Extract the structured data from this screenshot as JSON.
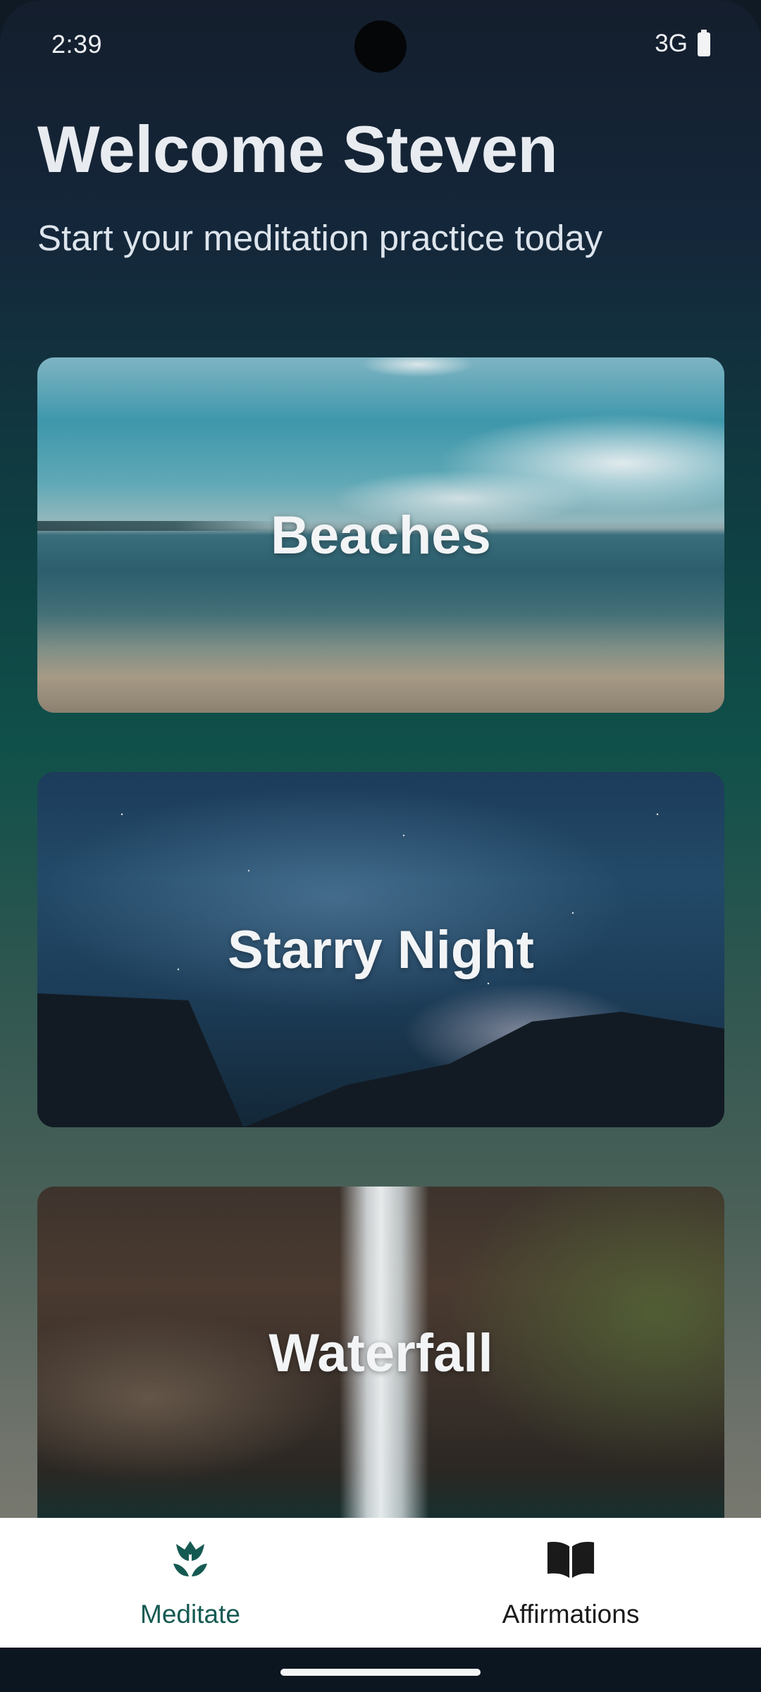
{
  "status_bar": {
    "time": "2:39",
    "network": "3G",
    "battery_icon": "battery-full-icon"
  },
  "header": {
    "title": "Welcome Steven",
    "subtitle": "Start your meditation practice today"
  },
  "cards": [
    {
      "label": "Beaches"
    },
    {
      "label": "Starry Night"
    },
    {
      "label": "Waterfall"
    }
  ],
  "bottom_nav": {
    "items": [
      {
        "label": "Meditate",
        "icon": "lotus-icon",
        "active": true,
        "color": "#155a52"
      },
      {
        "label": "Affirmations",
        "icon": "open-book-icon",
        "active": false,
        "color": "#1a1a1a"
      }
    ]
  },
  "colors": {
    "accent": "#155a52",
    "nav_background": "#ffffff"
  }
}
